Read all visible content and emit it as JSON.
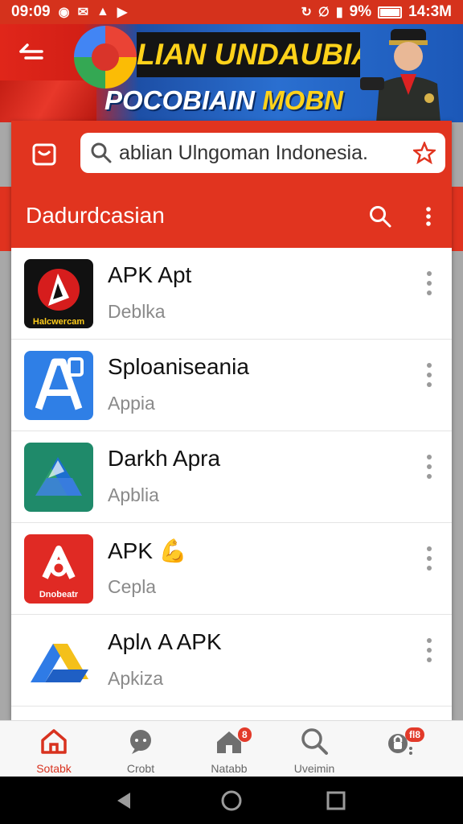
{
  "status_bar": {
    "time_left": "09:09",
    "battery_percent": "9%",
    "time_right": "14:3M",
    "icons_left": [
      "notification-icon",
      "message-icon",
      "alert-icon",
      "play-icon"
    ],
    "icons_right": [
      "data-icon",
      "mute-icon",
      "signal-icon"
    ]
  },
  "banner": {
    "line1": "LIAN UNDAUBIAN",
    "line2_a": "POCOBIAIN",
    "line2_b": "MOBN"
  },
  "search": {
    "value": "ablian Ulngoman Indonesia."
  },
  "toolbar": {
    "title": "Dadurdcasian"
  },
  "apps": [
    {
      "name": "APK Apt",
      "sub": "Deblka",
      "icon_label": "Halcwercam",
      "icon": "app-logo-red-black"
    },
    {
      "name": "Sploaniseania",
      "sub": "Appia",
      "icon_label": "",
      "icon": "app-logo-blue-a"
    },
    {
      "name": "Darkh Apra",
      "sub": "Apblia",
      "icon_label": "",
      "icon": "app-logo-drive"
    },
    {
      "name": "APK 💪",
      "sub": "Cepla",
      "icon_label": "Dnobeatr",
      "icon": "app-logo-red-white"
    },
    {
      "name": "Aplᴧ A APK",
      "sub": "Apkiza",
      "icon_label": "",
      "icon": "app-logo-drive-blue"
    }
  ],
  "bottom_nav": {
    "items": [
      {
        "label": "Sotabk",
        "icon": "home-icon",
        "active": true
      },
      {
        "label": "Crobt",
        "icon": "chat-icon",
        "active": false
      },
      {
        "label": "Natabb",
        "icon": "house-icon",
        "active": false,
        "badge": "8"
      },
      {
        "label": "Uveimin",
        "icon": "search-icon",
        "active": false
      },
      {
        "label": "",
        "icon": "bag-icon",
        "active": false,
        "badge": "fl8"
      }
    ]
  },
  "colors": {
    "accent": "#e1341f",
    "banner_blue": "#2a6fd0",
    "title_yellow": "#ffd21a"
  }
}
